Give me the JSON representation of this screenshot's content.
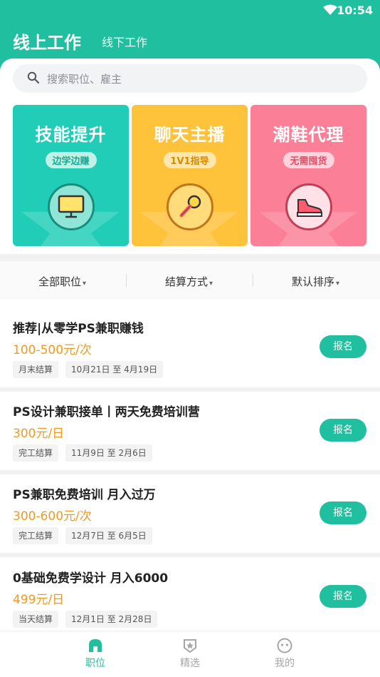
{
  "status_bar": {
    "time": "10:54"
  },
  "header": {
    "active_tab": "线上工作",
    "other_tab": "线下工作"
  },
  "search": {
    "placeholder": "搜索职位、雇主"
  },
  "banners": [
    {
      "title": "技能提升",
      "badge": "边学边赚",
      "icon": "monitor-icon",
      "bg": "#22cdb8",
      "badge_bg": "#bff1e7",
      "badge_color": "#1aa992"
    },
    {
      "title": "聊天主播",
      "badge": "1V1指导",
      "icon": "microphone-icon",
      "bg": "#ffc23b",
      "badge_bg": "#ffe6ad",
      "badge_color": "#d78b00"
    },
    {
      "title": "潮鞋代理",
      "badge": "无需囤货",
      "icon": "sneaker-icon",
      "bg": "#fb7f96",
      "badge_bg": "#ffd3dc",
      "badge_color": "#e34d68"
    }
  ],
  "filters": [
    "全部职位",
    "结算方式",
    "默认排序"
  ],
  "jobs": [
    {
      "title": " 推荐|从零学PS兼职赚钱",
      "salary": "100-500元/次",
      "settle": "月末结算",
      "dates": "10月21日 至 4月19日",
      "action": "报名"
    },
    {
      "title": "PS设计兼职接单丨两天免费培训营",
      "salary": "300元/日",
      "settle": "完工结算",
      "dates": "11月9日 至 2月6日",
      "action": "报名"
    },
    {
      "title": "PS兼职免费培训 月入过万",
      "salary": "300-600元/次",
      "settle": "完工结算",
      "dates": "12月7日 至 6月5日",
      "action": "报名"
    },
    {
      "title": "0基础免费学设计 月入6000",
      "salary": "499元/日",
      "settle": "当天结算",
      "dates": "12月1日 至 2月28日",
      "action": "报名"
    }
  ],
  "tabbar": [
    {
      "label": "职位",
      "icon": "job-home-icon",
      "active": true
    },
    {
      "label": "精选",
      "icon": "featured-star-icon",
      "active": false
    },
    {
      "label": "我的",
      "icon": "profile-face-icon",
      "active": false
    }
  ],
  "colors": {
    "primary": "#1fbf9f",
    "salary": "#f29a1f"
  }
}
